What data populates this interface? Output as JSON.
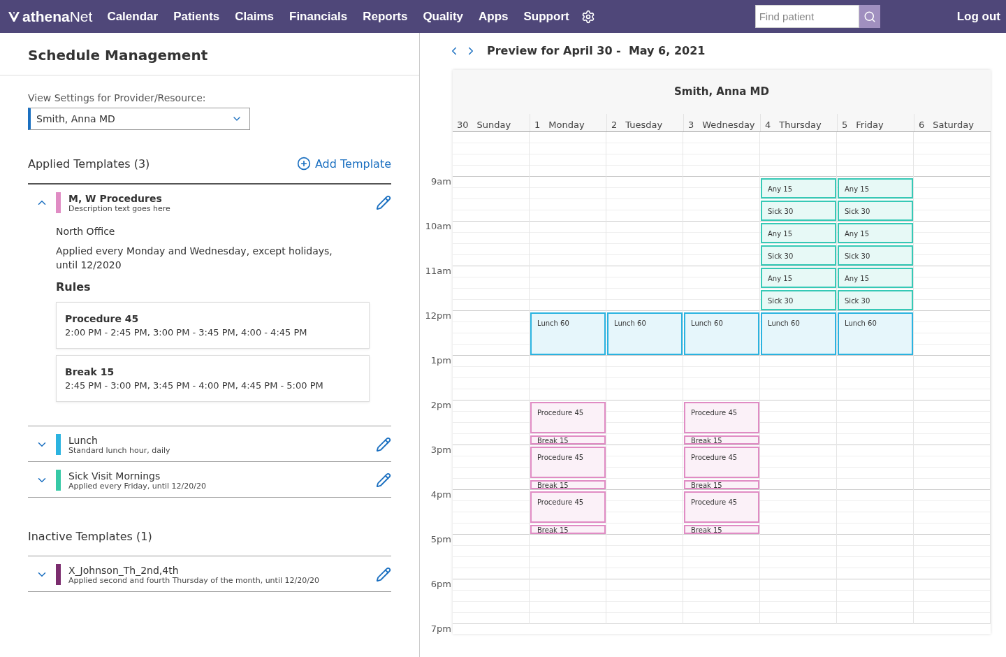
{
  "nav": {
    "logo": "**athena**Net",
    "items": [
      "Calendar",
      "Patients",
      "Claims",
      "Financials",
      "Reports",
      "Quality",
      "Apps",
      "Support"
    ],
    "search": {
      "placeholder": "Find patient"
    },
    "logout": "Log out"
  },
  "page": {
    "title": "Schedule Management"
  },
  "provider": {
    "label": "View Settings for Provider/Resource:",
    "value": "Smith, Anna MD"
  },
  "applied": {
    "heading": "Applied Templates (3)",
    "add": "Add Template",
    "templates": [
      {
        "name": "M, W Procedures",
        "description": "Description text goes here",
        "color": "#e08cc4",
        "expanded": true,
        "location": "North Office",
        "schedule": "Applied every Monday and Wednesday, except holidays, until 12/2020",
        "rules_heading": "Rules",
        "rules": [
          {
            "name": "Procedure 45",
            "times": "2:00 PM - 2:45 PM, 3:00 PM - 3:45 PM, 4:00 - 4:45 PM"
          },
          {
            "name": "Break 15",
            "times": "2:45 PM - 3:00 PM, 3:45 PM - 4:00 PM, 4:45 PM - 5:00 PM"
          }
        ]
      },
      {
        "name": "Lunch",
        "description": "Standard lunch hour, daily",
        "color": "#2bb3e0",
        "expanded": false
      },
      {
        "name": "Sick Visit Mornings",
        "description": "Applied every Friday, until 12/20/20",
        "color": "#36c9a6",
        "expanded": false
      }
    ]
  },
  "inactive": {
    "heading": "Inactive Templates (1)",
    "templates": [
      {
        "name": "X_Johnson_Th_2nd,4th",
        "description": "Applied second and fourth Thursday of the month, until 12/20/20",
        "color": "#7b2d6e",
        "expanded": false
      }
    ]
  },
  "preview": {
    "title": "Preview for April 30 -  May 6, 2021",
    "calendar": {
      "title": "Smith, Anna MD",
      "hours": [
        "9am",
        "10am",
        "11am",
        "12pm",
        "1pm",
        "2pm",
        "3pm",
        "4pm",
        "5pm",
        "6pm",
        "7pm"
      ],
      "days": [
        {
          "date": "30",
          "name": "Sunday"
        },
        {
          "date": "1",
          "name": "Monday",
          "events": [
            {
              "label": "Lunch 60",
              "kind": "lunch",
              "color": "#2bb3e0"
            },
            {
              "label": "Procedure 45",
              "kind": "procedure",
              "color": "#e08cc4"
            },
            {
              "label": "Break 15",
              "kind": "break",
              "color": "#e08cc4"
            },
            {
              "label": "Procedure 45",
              "kind": "procedure",
              "color": "#e08cc4"
            },
            {
              "label": "Break 15",
              "kind": "break",
              "color": "#e08cc4"
            },
            {
              "label": "Procedure 45",
              "kind": "procedure",
              "color": "#e08cc4"
            },
            {
              "label": "Break 15",
              "kind": "break",
              "color": "#e08cc4"
            }
          ]
        },
        {
          "date": "2",
          "name": "Tuesday",
          "events": [
            {
              "label": "Lunch 60",
              "kind": "lunch",
              "color": "#2bb3e0"
            }
          ]
        },
        {
          "date": "3",
          "name": "Wednesday",
          "events": [
            {
              "label": "Lunch 60",
              "kind": "lunch",
              "color": "#2bb3e0"
            },
            {
              "label": "Procedure 45",
              "kind": "procedure",
              "color": "#e08cc4"
            },
            {
              "label": "Break 15",
              "kind": "break",
              "color": "#e08cc4"
            },
            {
              "label": "Procedure 45",
              "kind": "procedure",
              "color": "#e08cc4"
            },
            {
              "label": "Break 15",
              "kind": "break",
              "color": "#e08cc4"
            },
            {
              "label": "Procedure 45",
              "kind": "procedure",
              "color": "#e08cc4"
            },
            {
              "label": "Break 15",
              "kind": "break",
              "color": "#e08cc4"
            }
          ]
        },
        {
          "date": "4",
          "name": "Thursday",
          "events": [
            {
              "label": "Any 15",
              "kind": "sick",
              "color": "#36c9b6"
            },
            {
              "label": "Sick 30",
              "kind": "sick",
              "color": "#36c9b6"
            },
            {
              "label": "Any 15",
              "kind": "sick",
              "color": "#36c9b6"
            },
            {
              "label": "Sick 30",
              "kind": "sick",
              "color": "#36c9b6"
            },
            {
              "label": "Any 15",
              "kind": "sick",
              "color": "#36c9b6"
            },
            {
              "label": "Sick 30",
              "kind": "sick",
              "color": "#36c9b6"
            },
            {
              "label": "Lunch 60",
              "kind": "lunch",
              "color": "#2bb3e0"
            }
          ]
        },
        {
          "date": "5",
          "name": "Friday",
          "events": [
            {
              "label": "Any 15",
              "kind": "sick",
              "color": "#36c9b6"
            },
            {
              "label": "Sick 30",
              "kind": "sick",
              "color": "#36c9b6"
            },
            {
              "label": "Any 15",
              "kind": "sick",
              "color": "#36c9b6"
            },
            {
              "label": "Sick 30",
              "kind": "sick",
              "color": "#36c9b6"
            },
            {
              "label": "Any 15",
              "kind": "sick",
              "color": "#36c9b6"
            },
            {
              "label": "Sick 30",
              "kind": "sick",
              "color": "#36c9b6"
            },
            {
              "label": "Lunch 60",
              "kind": "lunch",
              "color": "#2bb3e0"
            }
          ]
        },
        {
          "date": "6",
          "name": "Saturday"
        }
      ]
    }
  }
}
